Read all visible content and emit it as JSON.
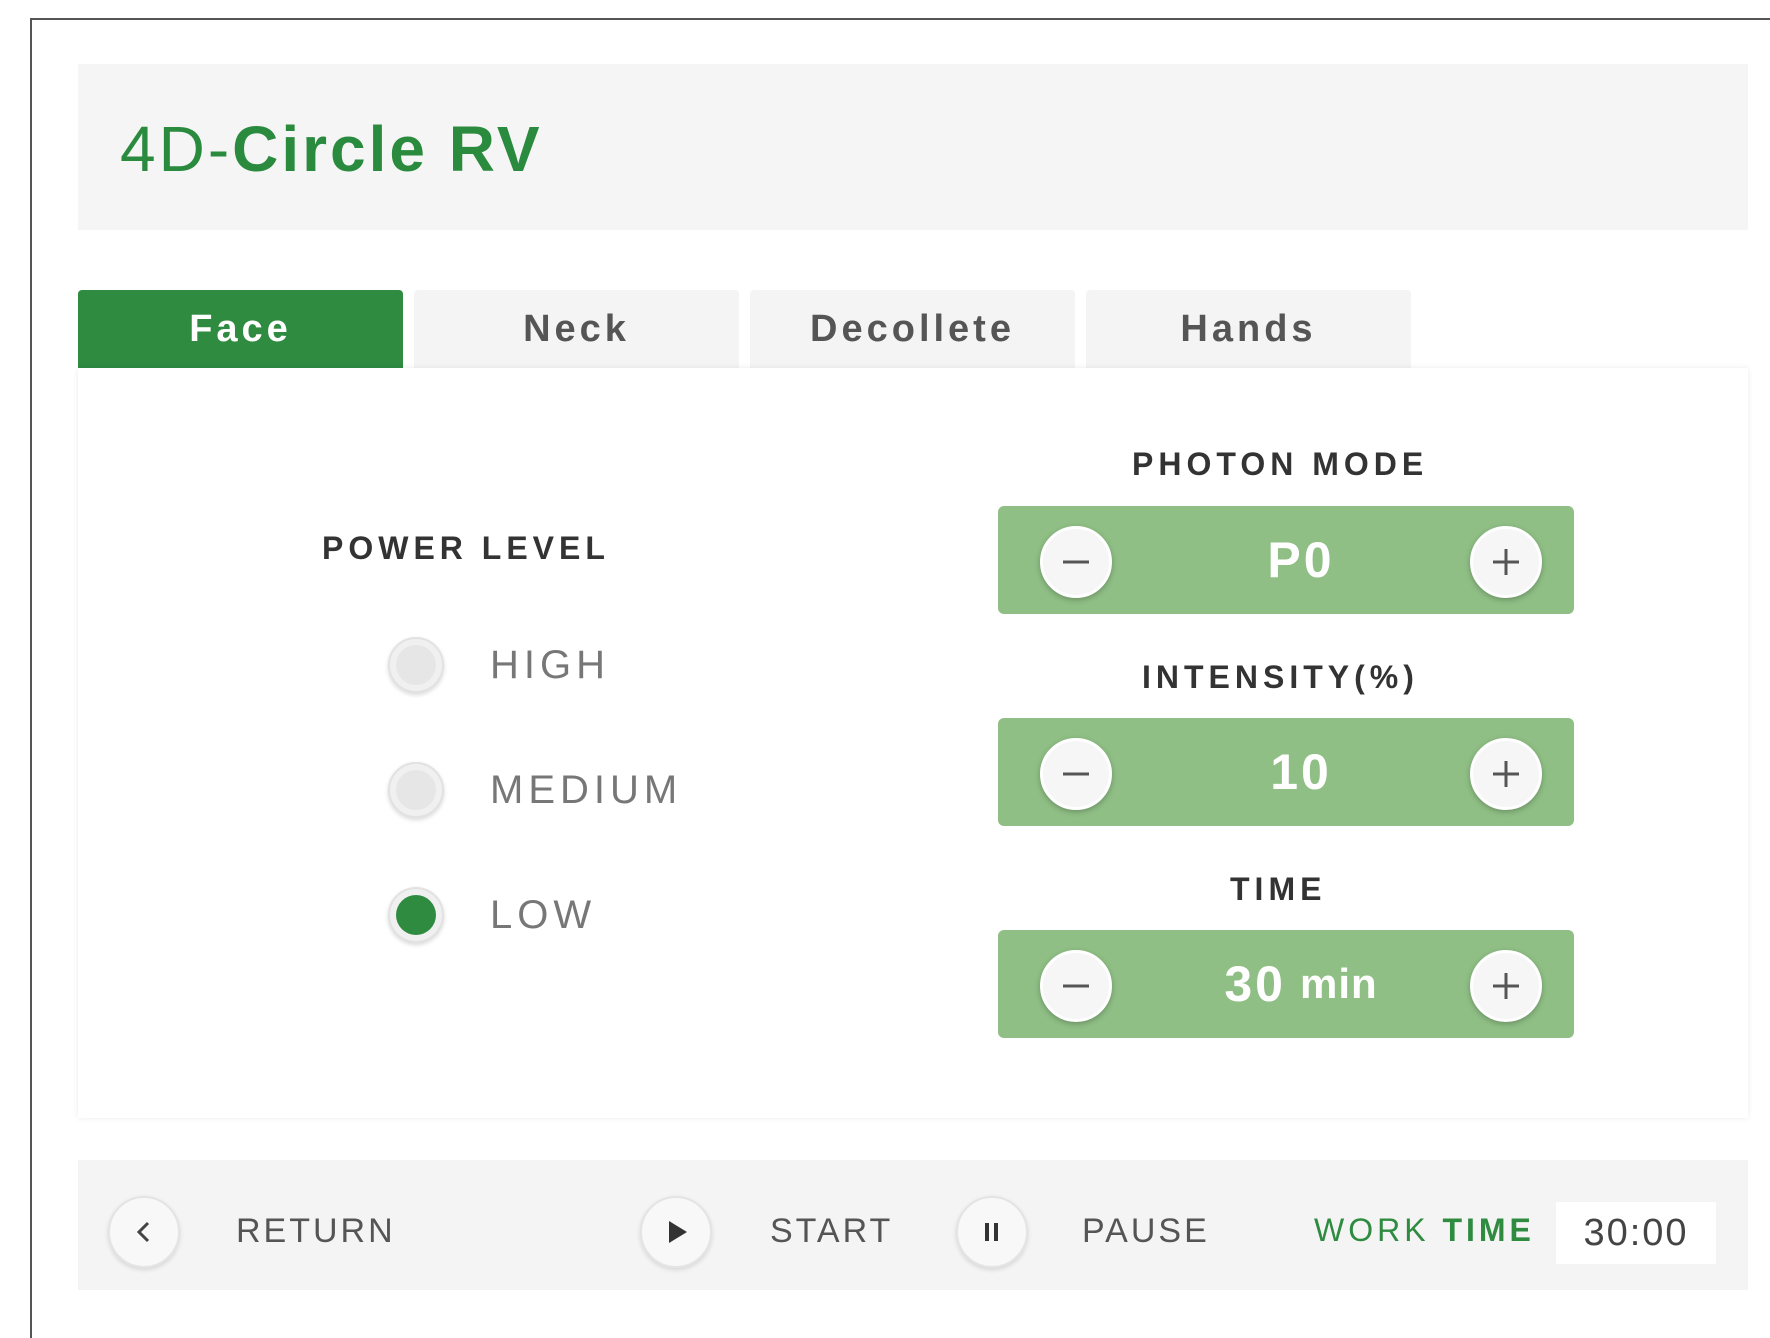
{
  "app": {
    "title_light": "4D-",
    "title_bold": "Circle RV"
  },
  "tabs": [
    {
      "label": "Face",
      "active": true
    },
    {
      "label": "Neck",
      "active": false
    },
    {
      "label": "Decollete",
      "active": false
    },
    {
      "label": "Hands",
      "active": false
    }
  ],
  "power": {
    "label": "POWER LEVEL",
    "options": [
      {
        "label": "HIGH",
        "checked": false
      },
      {
        "label": "MEDIUM",
        "checked": false
      },
      {
        "label": "LOW",
        "checked": true
      }
    ]
  },
  "photon": {
    "label": "PHOTON MODE",
    "value": "P0"
  },
  "intensity": {
    "label": "INTENSITY(%)",
    "value": "10"
  },
  "time": {
    "label": "TIME",
    "value": "30",
    "unit": "min"
  },
  "controls": {
    "return_label": "RETURN",
    "start_label": "START",
    "pause_label": "PAUSE",
    "work_label_light": "WORK",
    "work_label_bold": "TIME",
    "work_time": "30:00"
  },
  "icons": {
    "minus": "minus-icon",
    "plus": "plus-icon",
    "return": "chevron-left-icon",
    "start": "play-icon",
    "pause": "pause-icon"
  },
  "colors": {
    "brand_green": "#2e8b40",
    "stepper_green": "#8fbf85"
  }
}
